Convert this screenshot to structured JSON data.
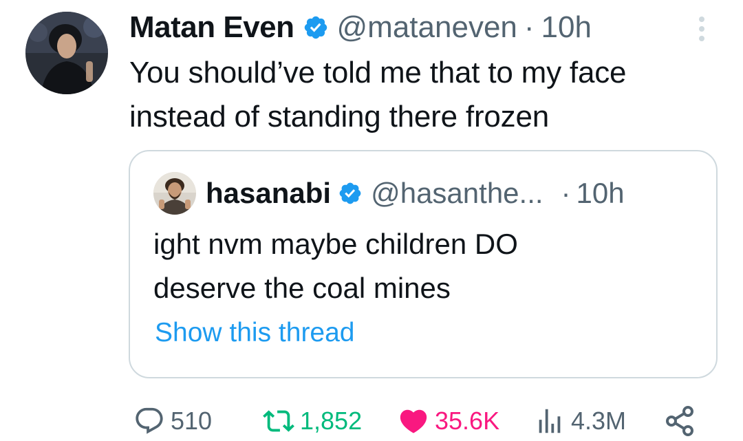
{
  "tweet": {
    "author": {
      "display_name": "Matan Even",
      "handle": "@mataneven",
      "verified": true,
      "avatar_icon": "profile-photo"
    },
    "separator": "·",
    "timestamp": "10h",
    "text_lines": [
      "You should’ve told me that to my face",
      "instead of standing there frozen"
    ]
  },
  "quote": {
    "author": {
      "display_name": "hasanabi",
      "handle": "@hasanthe...",
      "verified": true,
      "avatar_icon": "profile-photo"
    },
    "separator": "·",
    "timestamp": "10h",
    "text_lines": [
      "ight nvm maybe children DO",
      "deserve the coal mines"
    ],
    "show_thread": "Show this thread"
  },
  "actions": {
    "replies": "510",
    "retweets": "1,852",
    "likes": "35.6K",
    "views": "4.3M"
  },
  "colors": {
    "text_primary": "#0f1419",
    "text_secondary": "#536471",
    "link": "#1d9bf0",
    "verified": "#1d9bf0",
    "retweet_active": "#00ba7c",
    "like_active": "#f91880",
    "border": "#cfd9de"
  }
}
